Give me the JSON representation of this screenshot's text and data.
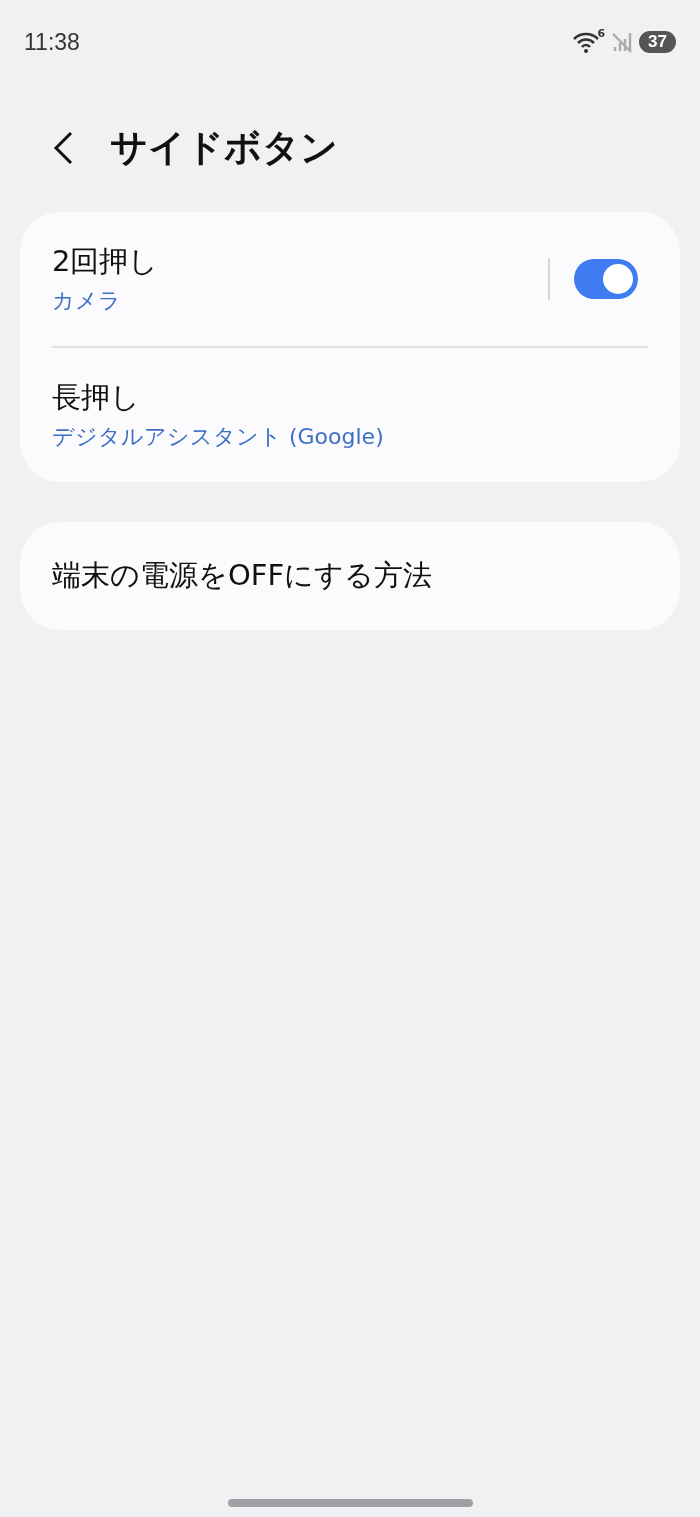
{
  "status_bar": {
    "time": "11:38",
    "network_type": "6",
    "battery": "37"
  },
  "header": {
    "title": "サイドボタン"
  },
  "cards": [
    {
      "items": [
        {
          "kind": "toggle",
          "title": "2回押し",
          "subtitle": "カメラ",
          "on": true
        },
        {
          "kind": "plain",
          "title": "長押し",
          "subtitle": "デジタルアシスタント (Google)"
        }
      ]
    },
    {
      "items": [
        {
          "kind": "plain",
          "title": "端末の電源をOFFにする方法"
        }
      ]
    }
  ]
}
